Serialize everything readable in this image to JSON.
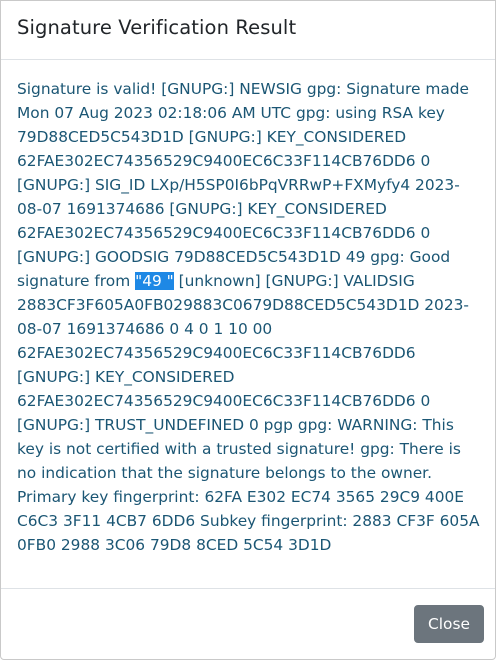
{
  "dialog": {
    "title": "Signature Verification Result",
    "close_label": "Close"
  },
  "result": {
    "text_before": "Signature is valid! [GNUPG:] NEWSIG gpg: Signature made Mon 07 Aug 2023 02:18:06 AM UTC gpg: using RSA key 79D88CED5C543D1D [GNUPG:] KEY_CONSIDERED 62FAE302EC74356529C9400EC6C33F114CB76DD6 0 [GNUPG:] SIG_ID LXp/H5SP0I6bPqVRRwP+FXMyfy4 2023-08-07 1691374686 [GNUPG:] KEY_CONSIDERED 62FAE302EC74356529C9400EC6C33F114CB76DD6 0 [GNUPG:] GOODSIG 79D88CED5C543D1D 49 gpg: Good signature from ",
    "selected": "\"49 \"",
    "text_after": " [unknown] [GNUPG:] VALIDSIG 2883CF3F605A0FB029883C0679D88CED5C543D1D 2023-08-07 1691374686 0 4 0 1 10 00 62FAE302EC74356529C9400EC6C33F114CB76DD6 [GNUPG:] KEY_CONSIDERED 62FAE302EC74356529C9400EC6C33F114CB76DD6 0 [GNUPG:] TRUST_UNDEFINED 0 pgp gpg: WARNING: This key is not certified with a trusted signature! gpg: There is no indication that the signature belongs to the owner. Primary key fingerprint: 62FA E302 EC74 3565 29C9 400E C6C3 3F11 4CB7 6DD6 Subkey fingerprint: 2883 CF3F 605A 0FB0 2988 3C06 79D8 8CED 5C54 3D1D"
  },
  "colors": {
    "text": "#1b5674",
    "selection": "#1e88e5",
    "button": "#6c757d"
  }
}
